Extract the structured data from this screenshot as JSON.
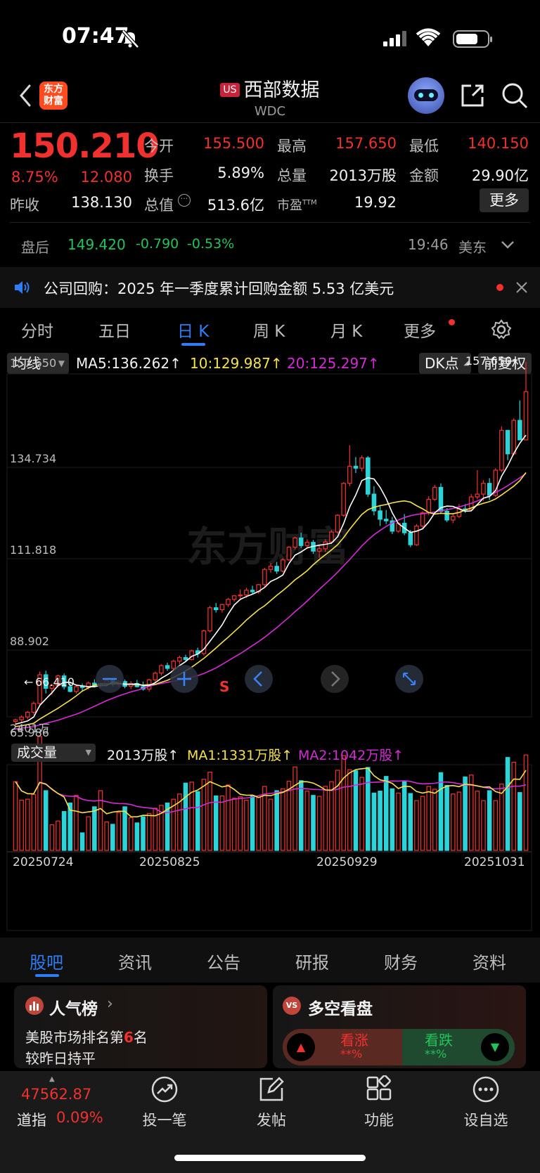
{
  "status_bar": {
    "time": "07:47"
  },
  "header": {
    "logo_text": "东方财富",
    "badge": "US",
    "name": "西部数据",
    "code": "WDC"
  },
  "quote": {
    "price": "150.210",
    "change_pct": "8.75%",
    "change": "12.080",
    "open_label": "今开",
    "open": "155.500",
    "high_label": "最高",
    "high": "157.650",
    "low_label": "最低",
    "low": "140.150",
    "turnover_label": "换手",
    "turnover": "5.89%",
    "volume_label": "总量",
    "volume": "2013万股",
    "amount_label": "金额",
    "amount": "29.90亿",
    "prev_close_label": "昨收",
    "prev_close": "138.130",
    "mktcap_label": "总值",
    "mktcap": "513.6亿",
    "pe_label": "市盈",
    "pe_sup": "TTM",
    "pe": "19.92",
    "more_label": "更多"
  },
  "after_hours": {
    "label": "盘后",
    "price": "149.420",
    "change": "-0.790",
    "pct": "-0.53%",
    "time": "19:46",
    "zone": "美东"
  },
  "notice": {
    "text": "公司回购：2025 年一季度累计回购金额 5.53 亿美元"
  },
  "kline_tabs": [
    "分时",
    "五日",
    "日 K",
    "周 K",
    "月 K",
    "更多"
  ],
  "ma_bar": {
    "selector": "均线",
    "ma5": "MA5:136.262",
    "ma10": "10:129.987",
    "ma20": "20:125.297",
    "dk": "DK点",
    "adj": "前复权"
  },
  "price_axis": {
    "top": "157.650",
    "mid1": "134.734",
    "mid2": "111.818",
    "mid3": "88.902",
    "bottom": "65.986",
    "max_marker": "157.650",
    "min_marker": "66.410"
  },
  "signal": "S",
  "watermark": "东方财富",
  "vol_bar": {
    "selector": "成交量",
    "vol": "2013万股",
    "ma1": "MA1:1331万股",
    "ma2": "MA2:1042万股",
    "axis_max": "2401万"
  },
  "dates": [
    "20250724",
    "20250825",
    "20250929",
    "20251031"
  ],
  "section_tabs": [
    "股吧",
    "资讯",
    "公告",
    "研报",
    "财务",
    "资料"
  ],
  "card_popularity": {
    "title": "人气榜",
    "line1_pre": "美股市场排名第",
    "rank": "6",
    "line1_post": "名",
    "line2": "较昨日持平"
  },
  "card_vs": {
    "badge": "VS",
    "title": "多空看盘",
    "bull": "看涨",
    "bull_pct": "**%",
    "bear": "看跌",
    "bear_pct": "**%"
  },
  "index_ticker": {
    "value": "47562.87",
    "name": "道指",
    "pct": "0.09%"
  },
  "bottom_nav": [
    "投一笔",
    "发帖",
    "功能",
    "设自选"
  ],
  "colors": {
    "up": "#f0312e",
    "down": "#2ad4d9",
    "ma5": "#ffffff",
    "ma10": "#f5e14a",
    "ma20": "#d62ad6",
    "accent": "#2f7df6"
  },
  "chart_data": {
    "type": "candlestick",
    "ylim": [
      65.986,
      157.65
    ],
    "ohlc": [
      [
        67.5,
        68.2,
        66.4,
        67.9
      ],
      [
        67.9,
        69.0,
        67.2,
        68.6
      ],
      [
        68.6,
        70.1,
        68.0,
        69.8
      ],
      [
        69.8,
        72.5,
        69.2,
        72.0
      ],
      [
        72.0,
        80.0,
        71.5,
        79.2
      ],
      [
        79.2,
        80.2,
        74.5,
        75.8
      ],
      [
        75.8,
        77.0,
        74.2,
        76.5
      ],
      [
        76.5,
        79.2,
        76.0,
        78.9
      ],
      [
        78.9,
        79.5,
        75.5,
        76.2
      ],
      [
        76.2,
        77.5,
        74.8,
        75.0
      ],
      [
        75.0,
        76.8,
        74.5,
        76.2
      ],
      [
        76.2,
        77.0,
        75.2,
        76.0
      ],
      [
        76.0,
        77.5,
        75.5,
        77.1
      ],
      [
        77.1,
        78.0,
        76.0,
        76.4
      ],
      [
        76.4,
        77.2,
        75.8,
        76.9
      ],
      [
        76.9,
        78.5,
        76.5,
        77.8
      ],
      [
        77.8,
        78.2,
        76.2,
        76.8
      ],
      [
        76.8,
        77.8,
        76.0,
        77.5
      ],
      [
        77.5,
        78.0,
        75.8,
        76.3
      ],
      [
        76.3,
        77.6,
        75.6,
        77.0
      ],
      [
        77.0,
        77.9,
        76.0,
        76.2
      ],
      [
        76.2,
        77.5,
        75.2,
        75.6
      ],
      [
        75.6,
        78.2,
        75.0,
        77.9
      ],
      [
        77.9,
        80.0,
        77.2,
        79.6
      ],
      [
        79.6,
        81.8,
        79.0,
        81.5
      ],
      [
        81.5,
        82.2,
        80.2,
        80.8
      ],
      [
        80.8,
        83.0,
        80.2,
        82.6
      ],
      [
        82.6,
        84.0,
        81.8,
        83.5
      ],
      [
        83.5,
        84.2,
        82.5,
        83.0
      ],
      [
        83.0,
        85.5,
        82.8,
        85.2
      ],
      [
        85.2,
        86.0,
        83.5,
        84.5
      ],
      [
        84.5,
        90.5,
        84.0,
        90.2
      ],
      [
        90.2,
        96.5,
        89.8,
        96.0
      ],
      [
        96.0,
        97.2,
        94.8,
        95.5
      ],
      [
        95.5,
        97.0,
        94.8,
        96.8
      ],
      [
        96.8,
        98.5,
        96.2,
        98.1
      ],
      [
        98.1,
        99.2,
        97.5,
        99.0
      ],
      [
        99.0,
        100.6,
        98.2,
        99.2
      ],
      [
        99.2,
        101.0,
        98.5,
        100.4
      ],
      [
        100.4,
        101.5,
        99.5,
        100.0
      ],
      [
        100.0,
        102.0,
        99.5,
        101.8
      ],
      [
        101.8,
        106.0,
        101.2,
        105.6
      ],
      [
        105.6,
        107.2,
        104.8,
        106.4
      ],
      [
        106.4,
        107.5,
        104.5,
        105.2
      ],
      [
        105.2,
        108.5,
        104.8,
        108.0
      ],
      [
        108.0,
        111.5,
        107.8,
        111.2
      ],
      [
        111.2,
        113.8,
        110.6,
        113.5
      ],
      [
        113.5,
        114.8,
        111.0,
        111.6
      ],
      [
        111.6,
        113.2,
        110.8,
        112.4
      ],
      [
        112.4,
        113.0,
        109.5,
        110.2
      ],
      [
        110.2,
        111.8,
        108.5,
        110.8
      ],
      [
        110.8,
        113.2,
        110.0,
        112.5
      ],
      [
        112.5,
        115.5,
        112.0,
        115.0
      ],
      [
        115.0,
        119.5,
        114.5,
        119.2
      ],
      [
        119.2,
        127.5,
        118.8,
        127.2
      ],
      [
        127.2,
        136.8,
        126.5,
        131.5
      ],
      [
        131.5,
        133.8,
        129.8,
        131.0
      ],
      [
        131.0,
        134.2,
        130.2,
        133.6
      ],
      [
        133.6,
        134.0,
        123.8,
        124.5
      ],
      [
        124.5,
        126.5,
        119.2,
        120.3
      ],
      [
        120.3,
        121.8,
        116.5,
        118.2
      ],
      [
        118.2,
        120.5,
        117.0,
        117.8
      ],
      [
        117.8,
        118.8,
        114.5,
        115.2
      ],
      [
        115.2,
        117.5,
        114.8,
        117.2
      ],
      [
        117.2,
        119.5,
        114.2,
        114.8
      ],
      [
        114.8,
        115.5,
        111.2,
        111.8
      ],
      [
        111.8,
        117.0,
        111.5,
        116.5
      ],
      [
        116.5,
        120.2,
        116.0,
        119.8
      ],
      [
        119.8,
        124.0,
        119.2,
        123.2
      ],
      [
        123.2,
        126.8,
        122.8,
        126.2
      ],
      [
        126.2,
        127.2,
        119.5,
        120.2
      ],
      [
        120.2,
        121.0,
        117.5,
        118.0
      ],
      [
        118.0,
        119.5,
        117.2,
        118.9
      ],
      [
        118.9,
        122.0,
        118.5,
        120.8
      ],
      [
        120.8,
        122.0,
        119.8,
        120.6
      ],
      [
        120.6,
        124.5,
        120.2,
        123.8
      ],
      [
        123.8,
        130.5,
        123.2,
        124.5
      ],
      [
        124.5,
        128.0,
        122.8,
        127.2
      ],
      [
        127.2,
        128.5,
        123.0,
        124.2
      ],
      [
        124.2,
        131.0,
        123.8,
        130.5
      ],
      [
        130.5,
        141.5,
        130.0,
        140.5
      ],
      [
        140.5,
        140.2,
        133.0,
        134.6
      ],
      [
        134.6,
        143.5,
        134.2,
        143.0
      ],
      [
        143.0,
        148.0,
        142.6,
        138.1
      ],
      [
        138.1,
        157.65,
        140.15,
        150.21
      ]
    ],
    "ma5": [
      66.8,
      67.2,
      67.6,
      68.6,
      71.5,
      73.1,
      74.7,
      76.5,
      77.3,
      77.3,
      76.6,
      76.4,
      76.2,
      76.2,
      76.5,
      76.5,
      77.4,
      77.1,
      76.8,
      76.8,
      76.9,
      76.5,
      76.5,
      77.2,
      78.3,
      79.2,
      80.3,
      81.5,
      82.5,
      83.8,
      84.4,
      85.6,
      87.6,
      89.6,
      91.7,
      94.4,
      96.7,
      98.1,
      98.8,
      99.4,
      100.1,
      101.1,
      102.6,
      103.3,
      104.2,
      107.1,
      109.2,
      110.0,
      111.0,
      111.4,
      111.7,
      111.9,
      112.2,
      113.8,
      117.1,
      121.3,
      124.3,
      127.9,
      128.6,
      128.3,
      126.2,
      123.4,
      119.8,
      117.1,
      116.0,
      114.9,
      115.2,
      115.8,
      117.5,
      119.8,
      121.1,
      121.5,
      121.4,
      120.8,
      120.2,
      120.3,
      121.9,
      123.5,
      123.9,
      125.4,
      129.0,
      131.6,
      134.7,
      137.3,
      139.3
    ],
    "ma10": [
      66.2,
      66.4,
      66.7,
      67.0,
      68.1,
      69.0,
      69.9,
      70.8,
      71.8,
      72.8,
      73.9,
      75.1,
      75.9,
      76.6,
      76.9,
      76.9,
      76.9,
      76.9,
      76.9,
      76.8,
      76.7,
      76.6,
      76.7,
      76.8,
      77.3,
      77.8,
      78.5,
      79.3,
      80.2,
      81.1,
      82.2,
      83.3,
      84.6,
      85.9,
      87.3,
      88.6,
      90.0,
      91.4,
      92.9,
      94.2,
      95.5,
      96.5,
      97.8,
      99.1,
      100.3,
      101.6,
      103.0,
      104.1,
      105.3,
      106.8,
      108.1,
      109.3,
      110.5,
      111.8,
      113.6,
      115.7,
      117.6,
      119.4,
      120.6,
      121.2,
      121.6,
      121.9,
      122.3,
      122.6,
      122.8,
      122.5,
      121.6,
      120.8,
      119.9,
      119.5,
      119.7,
      119.6,
      119.6,
      119.9,
      120.5,
      121.0,
      121.7,
      122.2,
      122.6,
      123.3,
      124.3,
      125.4,
      126.5,
      127.9,
      129.9
    ],
    "ma20": [
      65.6,
      65.8,
      66.0,
      66.2,
      66.6,
      67.0,
      67.4,
      67.8,
      68.3,
      68.8,
      69.3,
      69.9,
      70.6,
      71.3,
      72.0,
      72.7,
      73.3,
      73.9,
      74.4,
      74.9,
      75.3,
      75.8,
      76.3,
      76.7,
      77.0,
      77.3,
      77.6,
      77.9,
      78.2,
      78.6,
      79.0,
      79.5,
      80.2,
      80.9,
      81.8,
      82.7,
      83.6,
      84.5,
      85.5,
      86.5,
      87.5,
      88.6,
      89.8,
      91.0,
      92.3,
      93.6,
      95.0,
      96.3,
      97.7,
      99.1,
      100.6,
      102.0,
      103.4,
      104.9,
      106.5,
      108.1,
      109.8,
      111.5,
      113.0,
      114.3,
      115.4,
      116.4,
      117.3,
      118.0,
      118.6,
      119.1,
      119.4,
      119.6,
      119.8,
      120.0,
      120.3,
      120.6,
      120.9,
      121.3,
      121.7,
      122.2,
      122.8,
      123.4,
      124.1,
      124.9,
      125.7,
      126.6,
      127.6,
      128.6,
      129.7
    ],
    "volume_unit": "万股",
    "volume": [
      1450,
      1060,
      1080,
      1180,
      2401,
      1260,
      540,
      620,
      820,
      1000,
      1160,
      370,
      710,
      920,
      1260,
      600,
      550,
      800,
      920,
      690,
      580,
      710,
      780,
      890,
      950,
      1000,
      1080,
      1190,
      1420,
      1440,
      1240,
      1500,
      1650,
      1150,
      1150,
      1380,
      1100,
      1130,
      1060,
      1160,
      1120,
      1350,
      1080,
      1260,
      1300,
      1460,
      1760,
      1470,
      1250,
      1160,
      1140,
      1350,
      1450,
      1690,
      2000,
      1700,
      1680,
      1540,
      1750,
      1210,
      1250,
      1560,
      1300,
      1210,
      1450,
      1200,
      1050,
      1140,
      1350,
      1290,
      1640,
      1370,
      1190,
      1230,
      1550,
      1590,
      1250,
      1050,
      1260,
      1050,
      1400,
      1960,
      1860,
      1220,
      2013
    ]
  }
}
